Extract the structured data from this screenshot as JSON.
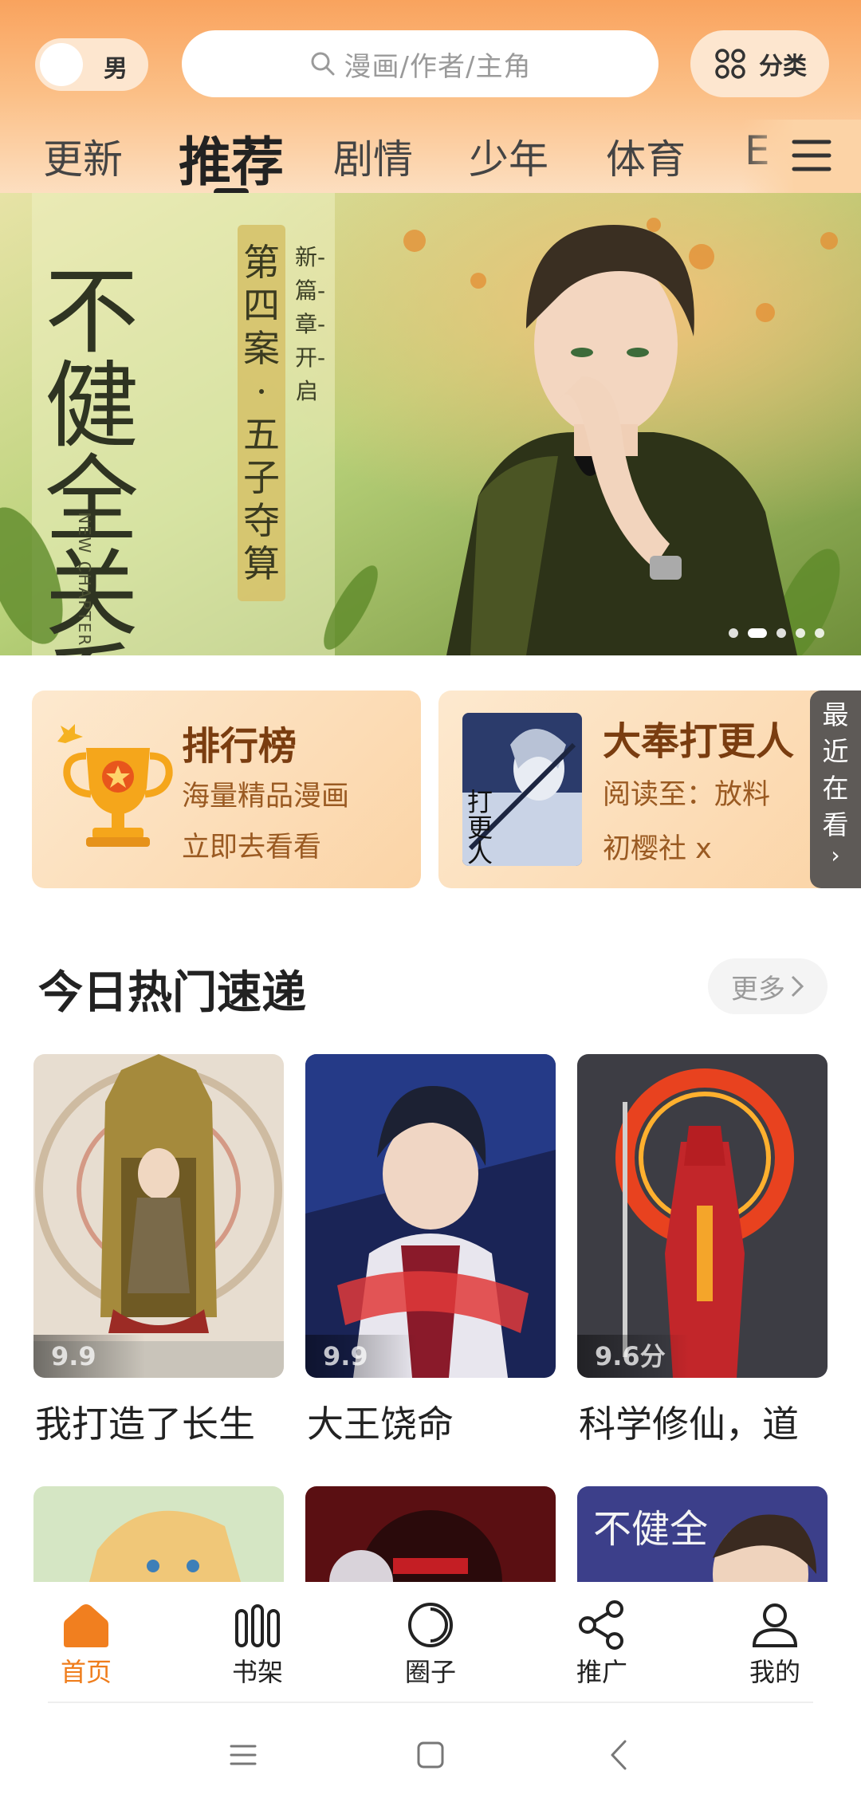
{
  "header": {
    "gender_label": "男",
    "search_placeholder": "漫画/作者/主角",
    "category_label": "分类"
  },
  "tabs": [
    {
      "label": "更新"
    },
    {
      "label": "推荐",
      "active": true
    },
    {
      "label": "剧情"
    },
    {
      "label": "少年"
    },
    {
      "label": "体育"
    },
    {
      "label": "E"
    }
  ],
  "banner": {
    "title": "不健全关系",
    "subtitle": "第四案·五子夺算",
    "tagline": "新-篇-章-开-启",
    "english": "NEW CHAPTER",
    "active_slide": 2,
    "slide_count": 5
  },
  "ranking_card": {
    "title": "排行榜",
    "line1": "海量精品漫画",
    "line2": "立即去看看"
  },
  "recent_card": {
    "title": "大奉打更人",
    "line1": "阅读至：放料",
    "line2": "初樱社 x",
    "cover_text": "打更人"
  },
  "recent_tab": {
    "chars": [
      "最",
      "近",
      "在",
      "看"
    ],
    "chevron": "›"
  },
  "section": {
    "title": "今日热门速递",
    "more_label": "更多"
  },
  "comics": [
    {
      "title": "我打造了长生",
      "score": "9.9"
    },
    {
      "title": "大王饶命",
      "score": "9.9"
    },
    {
      "title": "科学修仙，道",
      "score": "9.6分"
    }
  ],
  "bottom_nav": [
    {
      "label": "首页",
      "icon": "home-icon",
      "active": true
    },
    {
      "label": "书架",
      "icon": "bookshelf-icon"
    },
    {
      "label": "圈子",
      "icon": "circle-icon"
    },
    {
      "label": "推广",
      "icon": "share-icon"
    },
    {
      "label": "我的",
      "icon": "profile-icon"
    }
  ],
  "colors": {
    "accent": "#ef7d1c",
    "header_top": "#f9a35e",
    "promo_bg": "#fbd4a6"
  }
}
